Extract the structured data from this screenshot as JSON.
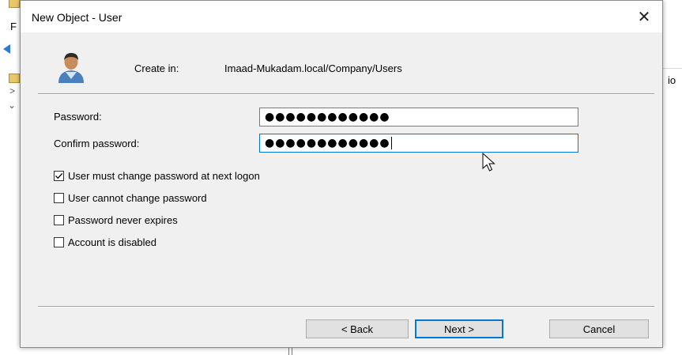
{
  "background": {
    "menu_letter": "F",
    "side_text": "io"
  },
  "dialog": {
    "title": "New Object - User",
    "close_glyph": "✕",
    "create_in_label": "Create in:",
    "create_in_path": "Imaad-Mukadam.local/Company/Users",
    "password_label": "Password:",
    "password_value": "●●●●●●●●●●●●",
    "confirm_label": "Confirm password:",
    "confirm_value": "●●●●●●●●●●●●",
    "options": [
      {
        "label": "User must change password at next logon",
        "checked": true
      },
      {
        "label": "User cannot change password",
        "checked": false
      },
      {
        "label": "Password never expires",
        "checked": false
      },
      {
        "label": "Account is disabled",
        "checked": false
      }
    ],
    "buttons": {
      "back": "< Back",
      "next": "Next >",
      "cancel": "Cancel"
    }
  },
  "colors": {
    "focus_accent": "#0078d7",
    "dialog_bg": "#f0f0f0"
  },
  "icons": [
    "user-icon",
    "close-icon",
    "checkbox-check-icon",
    "mouse-pointer-icon"
  ]
}
